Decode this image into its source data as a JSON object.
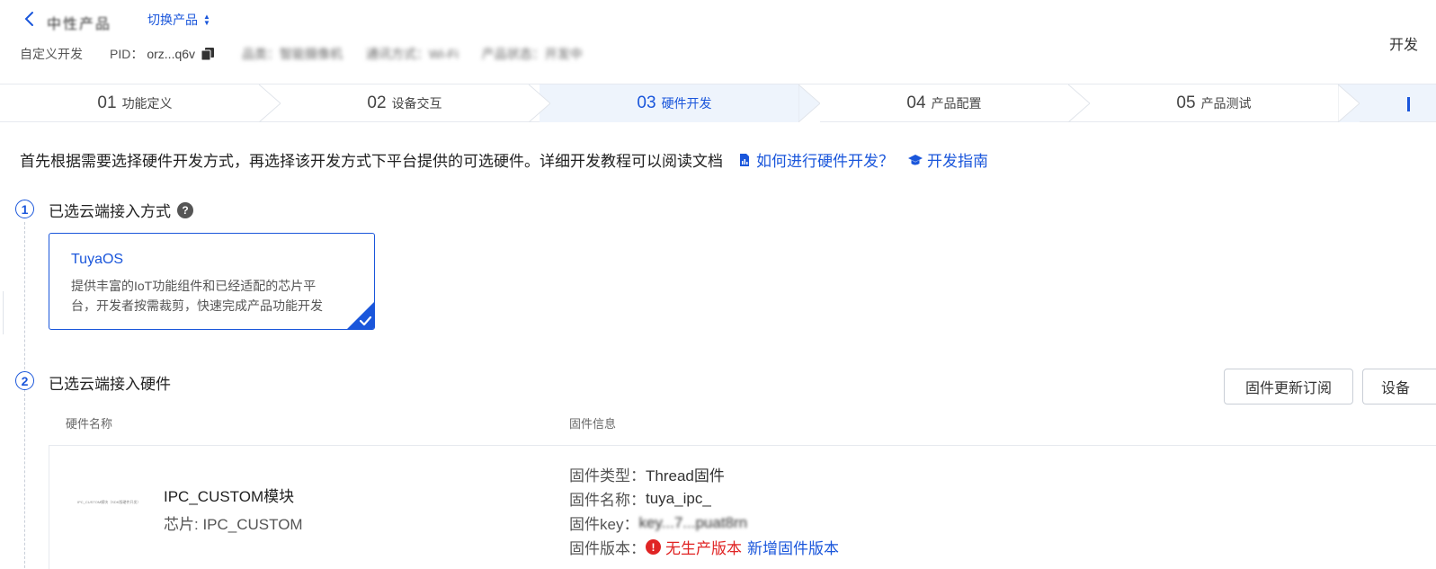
{
  "header": {
    "product_name": "中性产品",
    "switch_label": "切换产品",
    "category_tag": "自定义开发",
    "pid_label": "PID：",
    "pid_value": "orz...q6v",
    "meta_blurred": [
      "品类：智能摄像机",
      "通讯方式：Wi-Fi",
      "产品状态：开发中"
    ],
    "top_right": "开发"
  },
  "steps": [
    {
      "num": "01",
      "label": "功能定义",
      "active": false
    },
    {
      "num": "02",
      "label": "设备交互",
      "active": false
    },
    {
      "num": "03",
      "label": "硬件开发",
      "active": true
    },
    {
      "num": "04",
      "label": "产品配置",
      "active": false
    },
    {
      "num": "05",
      "label": "产品测试",
      "active": false
    }
  ],
  "instruction": {
    "text": "首先根据需要选择硬件开发方式，再选择该开发方式下平台提供的可选硬件。详细开发教程可以阅读文档",
    "link_how": "如何进行硬件开发？",
    "link_guide": "开发指南"
  },
  "section1": {
    "num": "1",
    "title": "已选云端接入方式",
    "help": "?",
    "card": {
      "title": "TuyaOS",
      "desc": "提供丰富的IoT功能组件和已经适配的芯片平台，开发者按需裁剪，快速完成产品功能开发"
    }
  },
  "section2": {
    "num": "2",
    "title": "已选云端接入硬件",
    "btn_subscribe": "固件更新订阅",
    "btn_device": "设备",
    "col_name": "硬件名称",
    "col_fw": "固件信息",
    "module": {
      "thumb_text": "IPC_CUSTOM模块（SDK版硬件开发）",
      "name": "IPC_CUSTOM模块",
      "chip": "芯片: IPC_CUSTOM"
    },
    "firmware": {
      "type_label": "固件类型：",
      "type_value": "Thread固件",
      "name_label": "固件名称：",
      "name_value": "tuya_ipc_",
      "key_label": "固件key：",
      "key_value": "key...7...puat8rn",
      "version_label": "固件版本：",
      "version_warn": "!",
      "no_version": "无生产版本",
      "add_version": "新增固件版本"
    }
  },
  "colors": {
    "primary": "#1a56db",
    "active_step_bg": "#eef4fc",
    "danger": "#e02424"
  }
}
